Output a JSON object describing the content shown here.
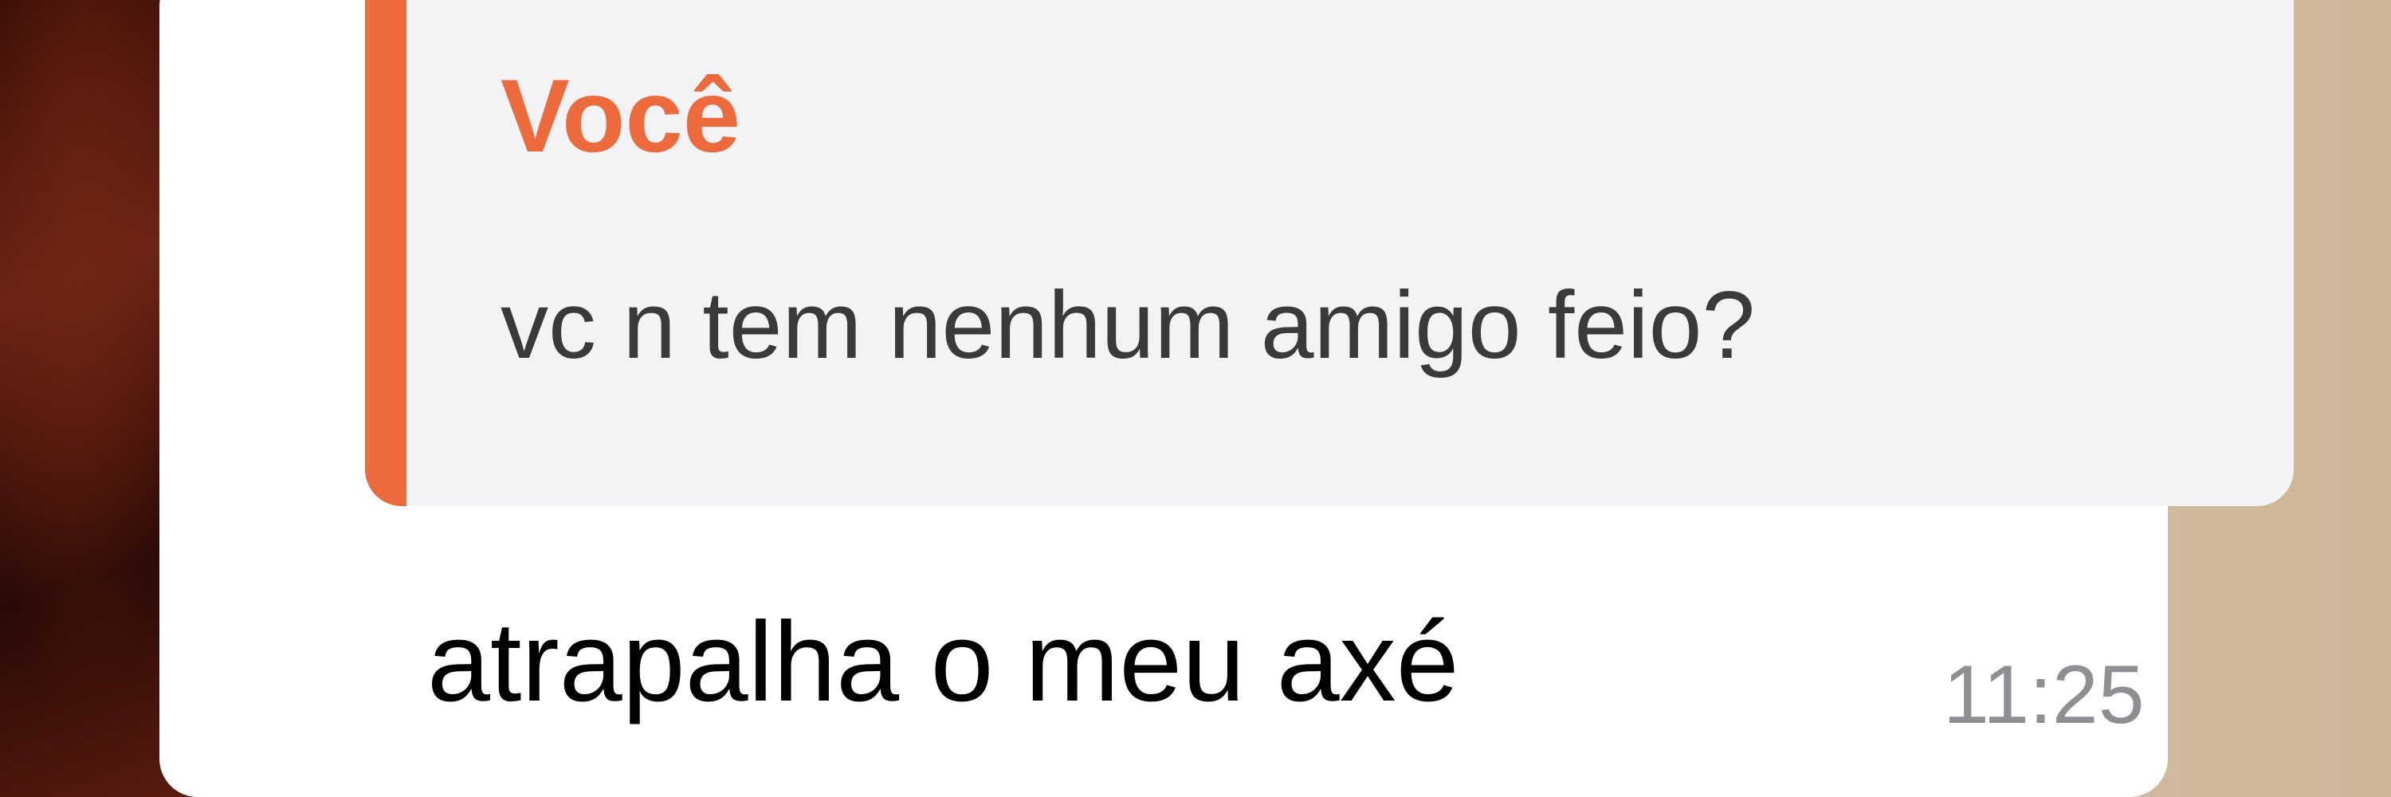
{
  "colors": {
    "accent": "#ec6a3b",
    "quote_background": "#f3f2f4",
    "bubble_background": "#ffffff",
    "timestamp": "#8e8e93"
  },
  "message": {
    "quote": {
      "author": "Você",
      "text": "vc n tem nenhum amigo feio?"
    },
    "text": "atrapalha o meu axé",
    "time": "11:25"
  }
}
